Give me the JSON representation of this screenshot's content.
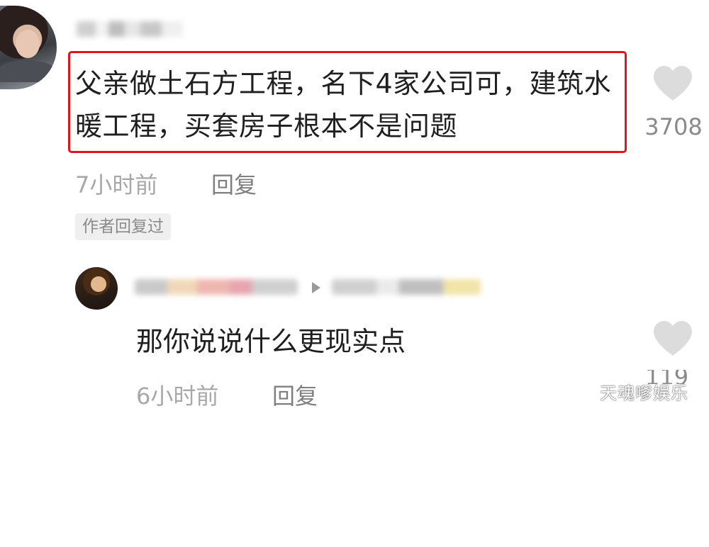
{
  "comment": {
    "text": "父亲做土石方工程，名下4家公司可，建筑水暖工程，买套房子根本不是问题",
    "likes": "3708",
    "time": "7小时前",
    "reply_label": "回复",
    "author_badge": "作者回复过"
  },
  "reply": {
    "text": "那你说说什么更现实点",
    "likes": "119",
    "time": "6小时前",
    "reply_label": "回复"
  },
  "watermark": "天魂嗲娱乐",
  "colors": {
    "highlight_border": "#e5141c",
    "heart": "#dcdcdc",
    "text": "#1f1f1f",
    "muted": "#a8a8a8"
  }
}
